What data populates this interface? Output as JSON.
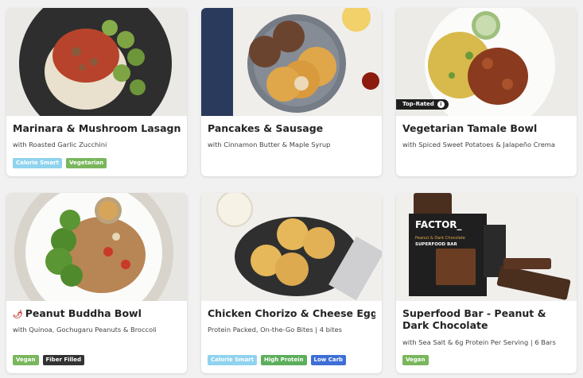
{
  "colors": {
    "calorie_smart": "#8fd3ee",
    "vegetarian": "#79b65c",
    "vegan": "#79b65c",
    "fiber_filled": "#333333",
    "high_protein": "#5cae5c",
    "low_carb": "#3d6fd6"
  },
  "meals": [
    {
      "title": "Marinara & Mushroom Lasagnette",
      "subtitle": "with Roasted Garlic Zucchini",
      "tags": [
        "Calorie Smart",
        "Vegetarian"
      ]
    },
    {
      "title": "Pancakes & Sausage",
      "subtitle": "with Cinnamon Butter & Maple Syrup",
      "tags": []
    },
    {
      "title": "Vegetarian Tamale Bowl",
      "subtitle": "with Spiced Sweet Potatoes & Jalapeño Crema",
      "badge": "Top-Rated",
      "badge_icon": "info-icon",
      "tags": []
    },
    {
      "title": "Peanut Buddha Bowl",
      "title_icon": "chili-pepper-icon",
      "subtitle": "with Quinoa, Gochugaru Peanuts & Broccoli",
      "tags": [
        "Vegan",
        "Fiber Filled"
      ]
    },
    {
      "title": "Chicken Chorizo & Cheese Egg Bites",
      "subtitle": "Protein Packed, On-the-Go Bites | 4 bites",
      "tags": [
        "Calorie Smart",
        "High Protein",
        "Low Carb"
      ]
    },
    {
      "title": "Superfood Bar - Peanut & Dark Chocolate",
      "subtitle": "with Sea Salt & 6g Protein Per Serving | 6 Bars",
      "tags": [
        "Vegan"
      ],
      "package": {
        "brand": "FACTOR_",
        "line1": "Peanut & Dark Chocolate",
        "line2": "SUPERFOOD BAR"
      }
    }
  ]
}
